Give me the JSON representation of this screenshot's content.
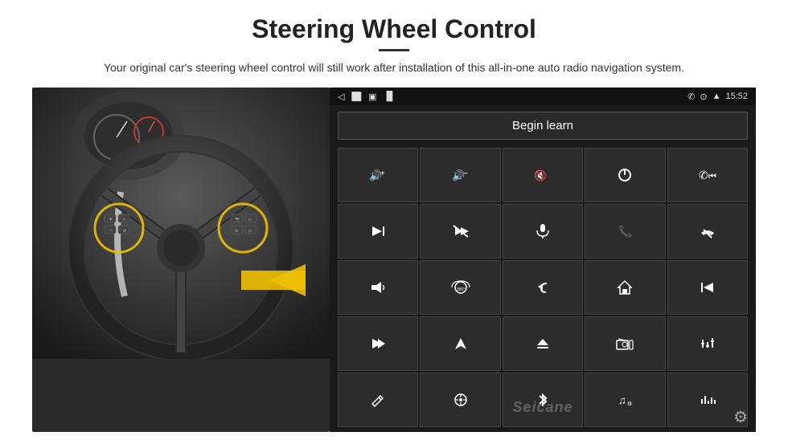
{
  "header": {
    "title": "Steering Wheel Control",
    "subtitle": "Your original car's steering wheel control will still work after installation of this all-in-one auto radio navigation system."
  },
  "status_bar": {
    "back_icon": "◁",
    "home_icon": "⬜",
    "recents_icon": "▣",
    "signal_icon": "▐▌",
    "phone_icon": "✆",
    "location_icon": "⊙",
    "wifi_icon": "▲",
    "time": "15:52"
  },
  "begin_learn": {
    "label": "Begin learn"
  },
  "controls": [
    {
      "icon": "🔊+",
      "label": "vol-up"
    },
    {
      "icon": "🔊-",
      "label": "vol-down"
    },
    {
      "icon": "🔇",
      "label": "mute"
    },
    {
      "icon": "⏻",
      "label": "power"
    },
    {
      "icon": "⏭",
      "label": "prev-track"
    },
    {
      "icon": "⏭",
      "label": "next"
    },
    {
      "icon": "⏩",
      "label": "fast-forward"
    },
    {
      "icon": "🎙",
      "label": "mic"
    },
    {
      "icon": "📞",
      "label": "call"
    },
    {
      "icon": "📞",
      "label": "end-call"
    },
    {
      "icon": "📢",
      "label": "horn"
    },
    {
      "icon": "360",
      "label": "360-cam"
    },
    {
      "icon": "↺",
      "label": "back"
    },
    {
      "icon": "🏠",
      "label": "home"
    },
    {
      "icon": "⏮",
      "label": "rewind"
    },
    {
      "icon": "⏭⏭",
      "label": "skip-fwd"
    },
    {
      "icon": "⬆",
      "label": "nav"
    },
    {
      "icon": "⏏",
      "label": "eject"
    },
    {
      "icon": "📻",
      "label": "radio"
    },
    {
      "icon": "⚙",
      "label": "eq"
    },
    {
      "icon": "✏",
      "label": "edit"
    },
    {
      "icon": "🔘",
      "label": "menu"
    },
    {
      "icon": "✱",
      "label": "bt"
    },
    {
      "icon": "🎵",
      "label": "music"
    },
    {
      "icon": "📊",
      "label": "eq2"
    }
  ],
  "watermark": "Seicane",
  "gear_icon": "⚙"
}
